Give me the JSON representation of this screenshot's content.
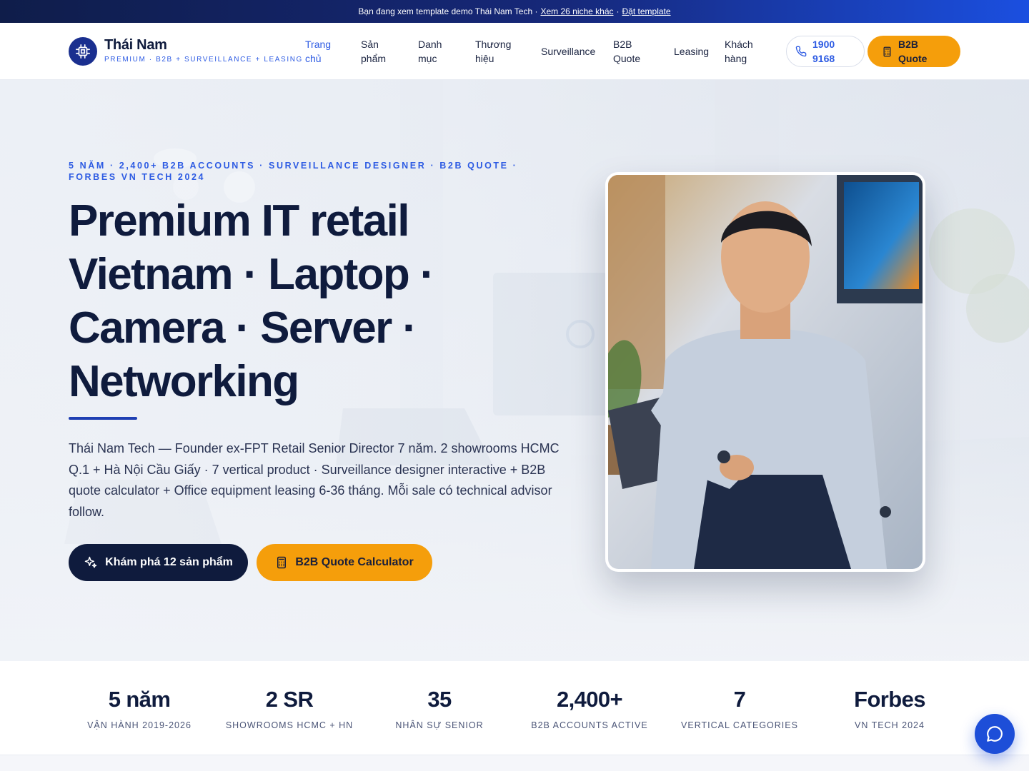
{
  "topbar": {
    "text": "Bạn đang xem template demo Thái Nam Tech ·",
    "link_more": "Xem 26 niche khác",
    "separator": "·",
    "link_order": "Đặt template"
  },
  "brand": {
    "name": "Thái Nam",
    "tagline": "PREMIUM · B2B + SURVEILLANCE + LEASING",
    "logo_icon": "chip-icon"
  },
  "nav": {
    "items": [
      {
        "line1": "Trang",
        "line2": "chủ",
        "active": true
      },
      {
        "line1": "Sản",
        "line2": "phẩm"
      },
      {
        "line1": "Danh",
        "line2": "mục"
      },
      {
        "line1": "Thương",
        "line2": "hiệu"
      },
      {
        "line1": "Surveillance"
      },
      {
        "line1": "B2B",
        "line2": "Quote"
      },
      {
        "line1": "Leasing"
      },
      {
        "line1": "Khách",
        "line2": "hàng"
      }
    ],
    "phone": {
      "line1": "1900",
      "line2": "9168",
      "icon": "phone-icon"
    },
    "quote": {
      "line1": "B2B",
      "line2": "Quote",
      "icon": "calculator-icon"
    }
  },
  "hero": {
    "eyebrow": "5 NĂM · 2,400+ B2B ACCOUNTS · SURVEILLANCE DESIGNER · B2B QUOTE · FORBES VN TECH 2024",
    "headline_lines": [
      "Premium IT retail",
      "Vietnam · Laptop ·",
      "Camera · Server ·",
      "Networking"
    ],
    "description": "Thái Nam Tech — Founder ex-FPT Retail Senior Director 7 năm. 2 showrooms HCMC Q.1 + Hà Nội Cầu Giấy · 7 vertical product · Surveillance designer interactive + B2B quote calculator + Office equipment leasing 6-36 tháng. Mỗi sale có technical advisor follow.",
    "cta_primary": "Khám phá 12 sản phẩm",
    "cta_primary_icon": "sparkles-icon",
    "cta_secondary": "B2B Quote Calculator",
    "cta_secondary_icon": "calculator-icon"
  },
  "stats": [
    {
      "value": "5 năm",
      "label": "VẬN HÀNH 2019-2026"
    },
    {
      "value": "2 SR",
      "label": "SHOWROOMS HCMC + HN"
    },
    {
      "value": "35",
      "label": "NHÂN SỰ SENIOR"
    },
    {
      "value": "2,400+",
      "label": "B2B ACCOUNTS ACTIVE"
    },
    {
      "value": "7",
      "label": "VERTICAL CATEGORIES"
    },
    {
      "value": "Forbes",
      "label": "VN TECH 2024"
    }
  ],
  "chat": {
    "icon": "chat-bubble-icon"
  },
  "colors": {
    "navy": "#0f1b3d",
    "blue_accent": "#2d5be3",
    "amber": "#f59e0b",
    "chat_blue": "#1d4ed8"
  }
}
